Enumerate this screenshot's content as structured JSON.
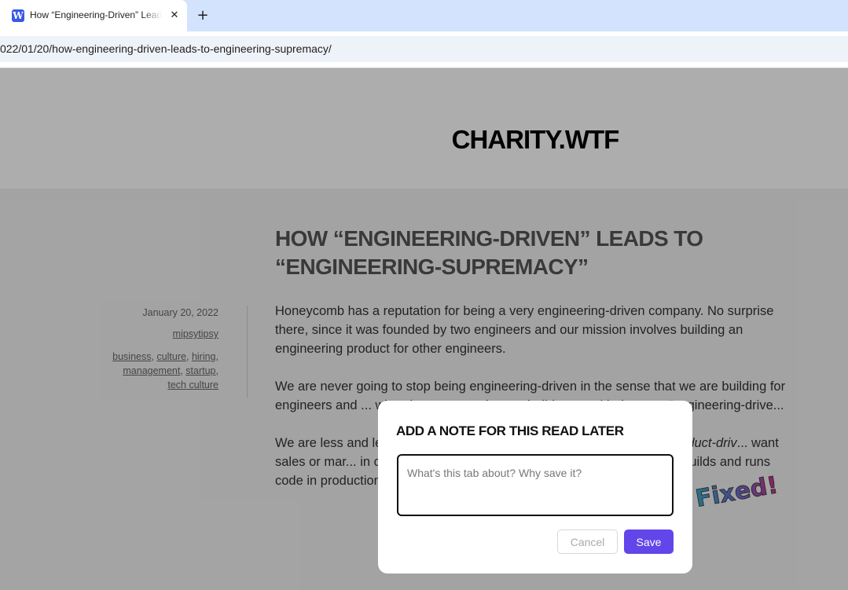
{
  "browser": {
    "tab_title": "How “Engineering-Driven” Leads to “Engineering-Supremacy”",
    "favicon_icon": "wordpress-icon",
    "favicon_letter": "W",
    "close_glyph": "✕",
    "new_tab_glyph": "+",
    "url": "022/01/20/how-engineering-driven-leads-to-engineering-supremacy/"
  },
  "site": {
    "title": "CHARITY.WTF"
  },
  "post": {
    "title": "HOW “ENGINEERING-DRIVEN” LEADS TO “ENGINEERING-SUPREMACY”",
    "date": "January 20, 2022",
    "author": "mipsytipsy",
    "categories": [
      "business",
      "culture",
      "hiring",
      "management",
      "startup",
      "tech culture"
    ],
    "paragraph1": "Honeycomb has a reputation for being a very engineering-driven company. No surprise there, since it was founded by two engineers and our mission involves building an engineering product for other engineers.",
    "paragraph2": "We are never going to stop being engineering-driven in the sense that we are building for engineers and ... when it comes to what we build, an... with the term “engineering-drive...",
    "paragraph3_a": "We are less and le... nowadays, for ent... this to be just as n... and a ",
    "paragraph3_em": "product-driv",
    "paragraph3_b": "... want sales or mar... in our journey towards revolutionizing the way the world builds and runs code in production.",
    "sticker_text": "Fixed!"
  },
  "modal": {
    "title": "ADD A NOTE FOR THIS READ LATER",
    "input_placeholder": "What's this tab about? Why save it?",
    "input_value": "",
    "cancel_label": "Cancel",
    "save_label": "Save"
  },
  "colors": {
    "accent": "#6246ea",
    "tabstrip": "#d3e3fd",
    "overlay": "rgba(0,0,0,0.32)"
  }
}
